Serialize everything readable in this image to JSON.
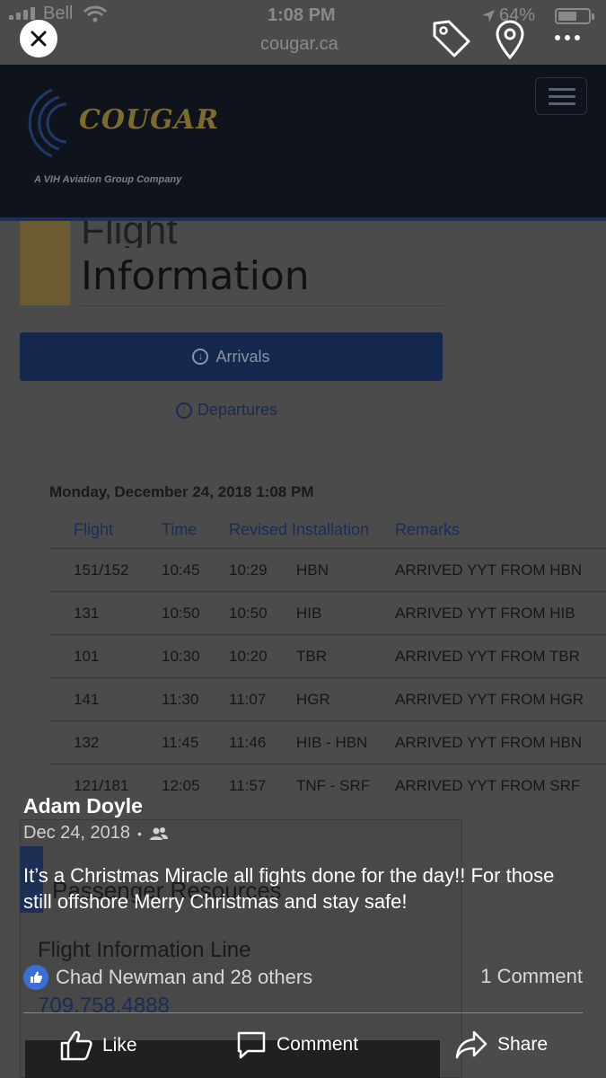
{
  "status_bar": {
    "carrier": "Bell",
    "time": "1:08 PM",
    "battery": "64%",
    "battery_level": 0.64,
    "url": "cougar.ca"
  },
  "site": {
    "logo_text": "COUGAR",
    "logo_subtitle": "A VIH Aviation Group Company",
    "page_heading_partial": "Flight",
    "page_heading": "Information",
    "arrivals_label": "Arrivals",
    "departures_label": "Departures",
    "date_line": "Monday, December 24, 2018 1:08 PM",
    "table": {
      "headers": {
        "flight": "Flight",
        "time": "Time",
        "revised_installation": "Revised Installation",
        "remarks": "Remarks"
      },
      "rows": [
        {
          "flight": "151/152",
          "time": "10:45",
          "revised": "10:29",
          "installation": "HBN",
          "remarks": "ARRIVED YYT FROM HBN"
        },
        {
          "flight": "131",
          "time": "10:50",
          "revised": "10:50",
          "installation": "HIB",
          "remarks": "ARRIVED YYT FROM HIB"
        },
        {
          "flight": "101",
          "time": "10:30",
          "revised": "10:20",
          "installation": "TBR",
          "remarks": "ARRIVED YYT FROM TBR"
        },
        {
          "flight": "141",
          "time": "11:30",
          "revised": "11:07",
          "installation": "HGR",
          "remarks": "ARRIVED YYT FROM HGR"
        },
        {
          "flight": "132",
          "time": "11:45",
          "revised": "11:46",
          "installation": "HIB - HBN",
          "remarks": "ARRIVED YYT FROM HBN"
        },
        {
          "flight": "121/181",
          "time": "12:05",
          "revised": "11:57",
          "installation": "TNF - SRF",
          "remarks": "ARRIVED YYT FROM SRF"
        }
      ]
    },
    "sidebar": {
      "title": "Passenger Resources",
      "line_label": "Flight Information Line",
      "phone": "709.758.4888"
    }
  },
  "post": {
    "author": "Adam Doyle",
    "date": "Dec 24, 2018",
    "body": "It’s a Christmas Miracle all fights done for the day!! For those still offshore Merry Christmas and stay safe!",
    "reactions": "Chad Newman and 28 others",
    "comments": "1 Comment",
    "actions": {
      "like": "Like",
      "comment": "Comment",
      "share": "Share"
    }
  },
  "icons": {
    "close": "close-icon",
    "tag": "tag-icon",
    "location": "location-pin-icon",
    "more": "more-dots-icon",
    "audience": "friends-icon"
  }
}
